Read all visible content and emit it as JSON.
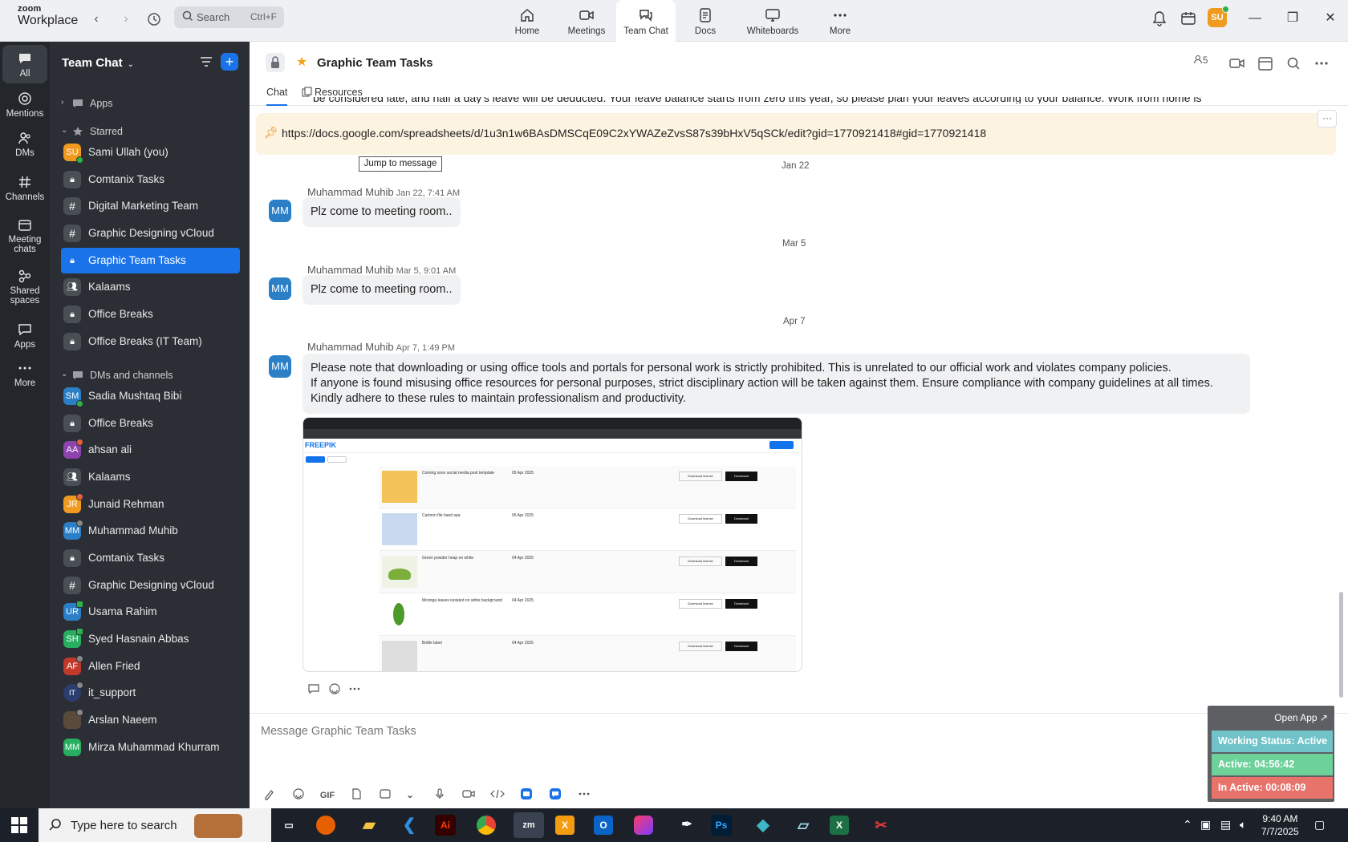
{
  "app": {
    "brand_top": "zoom",
    "brand_bottom": "Workplace"
  },
  "search": {
    "placeholder": "Search",
    "shortcut": "Ctrl+F"
  },
  "top_tabs": [
    {
      "label": "Home"
    },
    {
      "label": "Meetings"
    },
    {
      "label": "Team Chat"
    },
    {
      "label": "Docs"
    },
    {
      "label": "Whiteboards"
    },
    {
      "label": "More"
    }
  ],
  "user_avatar": "SU",
  "rail": [
    {
      "label": "All"
    },
    {
      "label": "Mentions"
    },
    {
      "label": "DMs"
    },
    {
      "label": "Channels"
    },
    {
      "label": "Meeting chats"
    },
    {
      "label": "Shared spaces"
    },
    {
      "label": "Apps"
    },
    {
      "label": "More"
    }
  ],
  "sidebar": {
    "title": "Team Chat",
    "sections": {
      "apps": "Apps",
      "starred": "Starred",
      "dms": "DMs and channels"
    },
    "starred": [
      {
        "label": "Sami Ullah (you)",
        "initials": "SU",
        "color": "#f09a1f"
      },
      {
        "label": "Comtanix Tasks"
      },
      {
        "label": "Digital Marketing Team"
      },
      {
        "label": "Graphic Designing vCloud"
      },
      {
        "label": "Graphic Team Tasks"
      },
      {
        "label": "Kalaams"
      },
      {
        "label": "Office Breaks"
      },
      {
        "label": "Office Breaks (IT Team)"
      }
    ],
    "dms": [
      {
        "label": "Sadia Mushtaq Bibi",
        "initials": "SM",
        "color": "#2a7fc7"
      },
      {
        "label": "Office Breaks"
      },
      {
        "label": "ahsan ali",
        "initials": "AA",
        "color": "#8e44ad"
      },
      {
        "label": "Kalaams"
      },
      {
        "label": "Junaid Rehman",
        "initials": "JR",
        "color": "#f09a1f"
      },
      {
        "label": "Muhammad Muhib",
        "initials": "MM",
        "color": "#2a7fc7"
      },
      {
        "label": "Comtanix Tasks"
      },
      {
        "label": "Graphic Designing vCloud"
      },
      {
        "label": "Usama Rahim",
        "initials": "UR",
        "color": "#2a7fc7"
      },
      {
        "label": "Syed Hasnain Abbas",
        "initials": "SH",
        "color": "#27ae60"
      },
      {
        "label": "Allen Fried",
        "initials": "AF",
        "color": "#c0392b"
      },
      {
        "label": "it_support",
        "initials": "IT",
        "color": "#2c3e70"
      },
      {
        "label": "Arslan Naeem",
        "initials": "",
        "color": "#5a4a3a"
      },
      {
        "label": "Mirza Muhammad Khurram",
        "initials": "MM",
        "color": "#27ae60"
      }
    ]
  },
  "channel": {
    "title": "Graphic Team Tasks",
    "tabs": {
      "chat": "Chat",
      "resources": "Resources"
    },
    "members": "5"
  },
  "pinned": {
    "partial_text": "be considered late, and half a day's leave will be deducted. Your leave balance starts from zero this year, so please plan your leaves according to your balance. Work from home is",
    "url": "https://docs.google.com/spreadsheets/d/1u3n1w6BAsDMSCqE09C2xYWAZeZvsS87s39bHxV5qSCk/edit?gid=1770921418#gid=1770921418",
    "tooltip": "Jump to message"
  },
  "messages": [
    {
      "date": "Jan 22",
      "author": "Muhammad Muhib",
      "time": "Jan 22, 7:41 AM",
      "initials": "MM",
      "lines": [
        "Plz come to meeting room.."
      ]
    },
    {
      "date": "Mar 5",
      "author": "Muhammad Muhib",
      "time": "Mar 5, 9:01 AM",
      "initials": "MM",
      "lines": [
        "Plz come to meeting room.."
      ]
    },
    {
      "date": "Apr 7",
      "author": "Muhammad Muhib",
      "time": "Apr 7, 1:49 PM",
      "initials": "MM",
      "lines": [
        "Please note that downloading or using office tools and portals for personal work is strictly prohibited. This is unrelated to our official work and violates company policies.",
        "If anyone is found misusing office resources for personal purposes, strict disciplinary action will be taken against them. Ensure compliance with company guidelines at all times.",
        "Kindly adhere to these rules to maintain professionalism and productivity."
      ]
    }
  ],
  "screenshot": {
    "logo": "FREEPIK",
    "rows": [
      {
        "title": "Coming soon social media post template",
        "date": "05 Apr 2025"
      },
      {
        "title": "Cartoon file hand spa",
        "date": "05 Apr 2025"
      },
      {
        "title": "Green powder heap on white",
        "date": "04 Apr 2025"
      },
      {
        "title": "Moringa leaves isolated on white background",
        "date": "04 Apr 2025"
      },
      {
        "title": "Bottle label",
        "date": "04 Apr 2025"
      }
    ],
    "button_license": "Download license",
    "button_download": "Download"
  },
  "composer": {
    "placeholder": "Message Graphic Team Tasks",
    "gif": "GIF"
  },
  "widget": {
    "open_app": "Open App ↗",
    "status": "Working Status: Active",
    "active": "Active: 04:56:42",
    "inactive": "In Active: 00:08:09",
    "status_color": "#6fc3c9",
    "active_color": "#6dd19a",
    "inactive_color": "#e8736b"
  },
  "taskbar": {
    "search_placeholder": "Type here to search",
    "time": "9:40 AM",
    "date": "7/7/2025"
  }
}
